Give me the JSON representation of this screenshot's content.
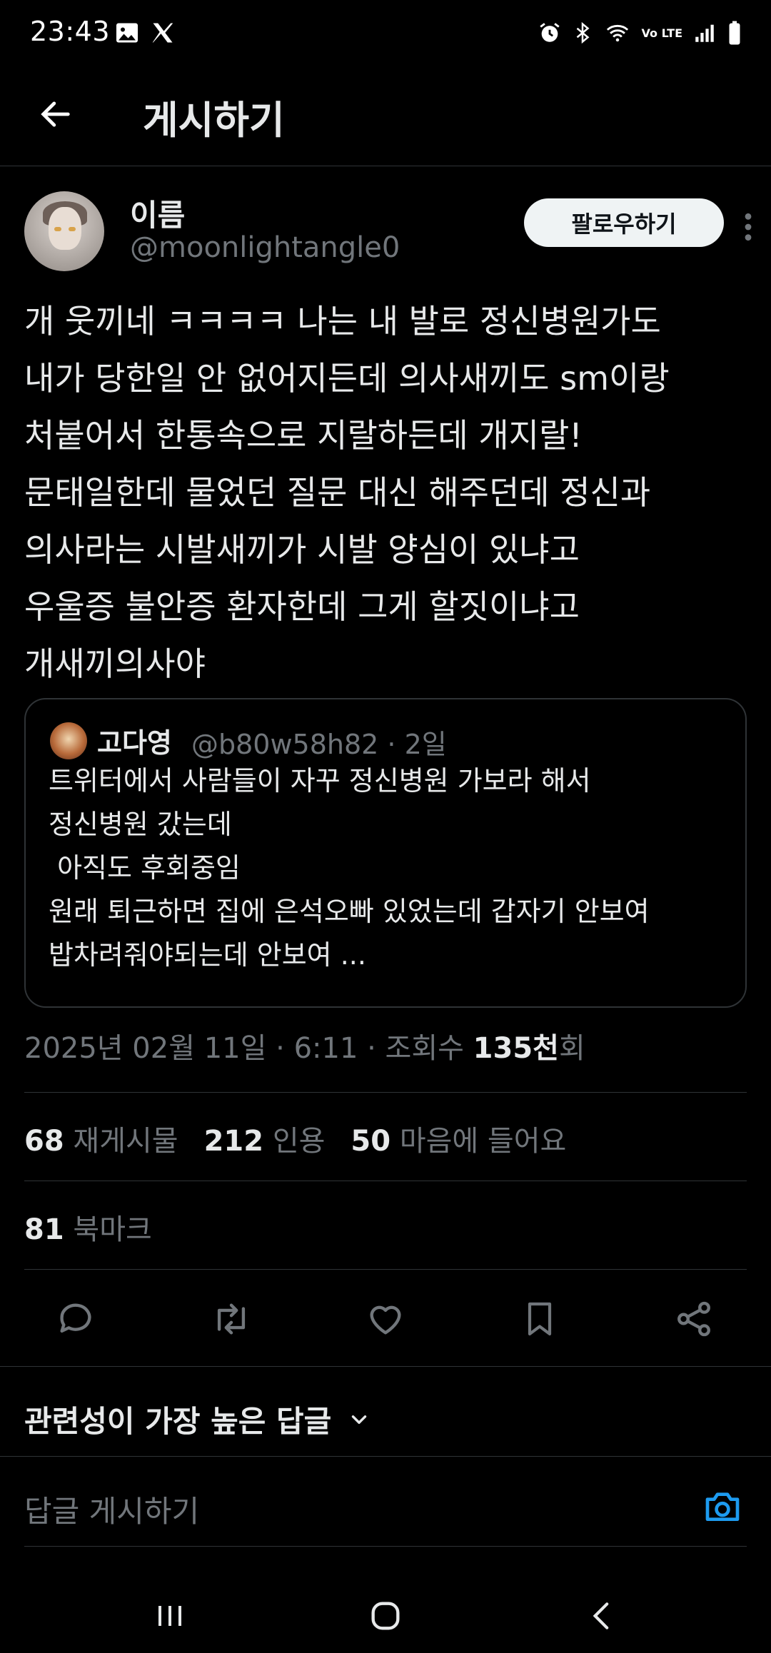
{
  "status_bar": {
    "time": "23:43",
    "icons_left": [
      "gallery-icon",
      "x-logo-icon"
    ],
    "icons_right": [
      "alarm-icon",
      "bluetooth-icon",
      "wifi-icon",
      "volte-icon",
      "signal-icon",
      "battery-icon"
    ],
    "volte_label": "Vo LTE"
  },
  "topbar": {
    "title": "게시하기"
  },
  "author": {
    "name": "이름",
    "handle": "@moonlightangle0",
    "follow_label": "팔로우하기"
  },
  "tweet": {
    "text": "개 웃끼네 ㅋㅋㅋㅋ 나는 내 발로 정신병원가도\n내가 당한일 안 없어지든데 의사새끼도 sm이랑\n처붙어서 한통속으로 지랄하든데 개지랄!\n문태일한데 물었던 질문 대신 해주던데 정신과\n의사라는 시발새끼가 시발 양심이 있냐고\n우울증 불안증 환자한데 그게 할짓이냐고\n개새끼의사야"
  },
  "quote": {
    "name": "고다영",
    "handle_time": "@b80w58h82 · 2일",
    "text": "트위터에서 사람들이 자꾸 정신병원 가보라 해서\n정신병원 갔는데\n 아직도 후회중임\n원래 퇴근하면 집에 은석오빠 있었는데 갑자기 안보여\n밥차려줘야되는데 안보여 ..."
  },
  "meta": {
    "timestamp_prefix": "2025년 02월 11일 · 6:11 · 조회수 ",
    "views": "135천",
    "views_suffix": "회"
  },
  "stats": {
    "reposts_count": "68",
    "reposts_label": "재게시물",
    "quotes_count": "212",
    "quotes_label": "인용",
    "likes_count": "50",
    "likes_label": "마음에 들어요",
    "bookmarks_count": "81",
    "bookmarks_label": "북마크"
  },
  "actions": [
    "reply-icon",
    "repost-icon",
    "like-icon",
    "bookmark-icon",
    "share-icon"
  ],
  "replies": {
    "sort_label": "관련성이 가장 높은 답글"
  },
  "reply_box": {
    "placeholder": "답글 게시하기"
  },
  "colors": {
    "background": "#000000",
    "text": "#e7e9ea",
    "muted": "#71767b",
    "border": "#2f3336",
    "accent": "#1d9bf0"
  }
}
